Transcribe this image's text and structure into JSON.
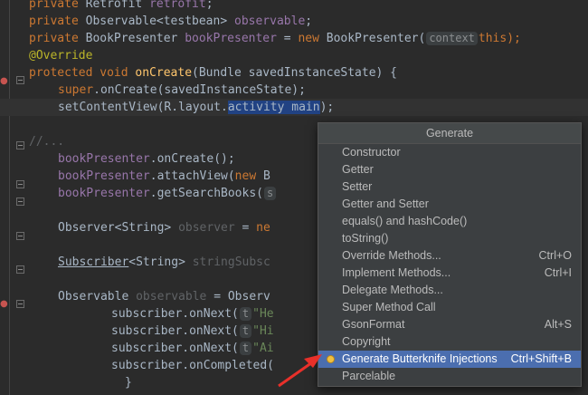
{
  "editor": {
    "lines": [
      {
        "tokens": [
          [
            "kw",
            "private "
          ],
          [
            "",
            "Retrofit "
          ],
          [
            "fld",
            "retrofit"
          ],
          [
            "",
            ";"
          ]
        ]
      },
      {
        "tokens": [
          [
            "kw",
            "private "
          ],
          [
            "",
            "Observable<testbean> "
          ],
          [
            "fld",
            "observable"
          ],
          [
            "",
            ";"
          ]
        ]
      },
      {
        "tokens": [
          [
            "kw",
            "private "
          ],
          [
            "",
            "BookPresenter "
          ],
          [
            "fld",
            "bookPresenter"
          ],
          [
            "",
            " = "
          ],
          [
            "kw",
            "new "
          ],
          [
            "",
            "BookPresenter("
          ]
        ]
      },
      {
        "tokens": [
          [
            "ann",
            "@Override"
          ]
        ]
      },
      {
        "tokens": [
          [
            "kw",
            "protected void "
          ],
          [
            "mth",
            "onCreate"
          ],
          [
            "",
            "(Bundle savedInstanceState) {"
          ]
        ]
      },
      {
        "tokens": [
          [
            "kw",
            "super"
          ],
          [
            "",
            ".onCreate(savedInstanceState);"
          ]
        ]
      },
      {
        "tokens": [
          [
            "",
            "setContentView(R.layout."
          ],
          [
            "hl",
            "activity main"
          ],
          [
            "",
            ");"
          ]
        ]
      },
      {
        "tokens": []
      },
      {
        "tokens": [
          [
            "gray",
            "//..."
          ]
        ]
      },
      {
        "tokens": [
          [
            "fld",
            "bookPresenter"
          ],
          [
            "",
            ".onCreate();"
          ]
        ]
      },
      {
        "tokens": [
          [
            "fld",
            "bookPresenter"
          ],
          [
            "",
            ".attachView("
          ],
          [
            "kw",
            "new "
          ],
          [
            "",
            "B"
          ]
        ]
      },
      {
        "tokens": [
          [
            "fld",
            "bookPresenter"
          ],
          [
            "",
            ".getSearchBooks("
          ]
        ]
      },
      {
        "tokens": []
      },
      {
        "tokens": [
          [
            "",
            "Observer<String> "
          ],
          [
            "gray",
            "observer"
          ],
          [
            "",
            " = "
          ],
          [
            "kw",
            "ne"
          ]
        ]
      },
      {
        "tokens": []
      },
      {
        "tokens": [
          [
            "u",
            "Subscriber"
          ],
          [
            "",
            "<String> "
          ],
          [
            "gray",
            "stringSubsc"
          ]
        ]
      },
      {
        "tokens": []
      },
      {
        "tokens": [
          [
            "",
            "Observable "
          ],
          [
            "gray",
            "observable"
          ],
          [
            "",
            " = Observ"
          ]
        ]
      },
      {
        "tokens": [
          [
            "",
            "subscriber.onNext("
          ]
        ]
      },
      {
        "tokens": [
          [
            "",
            "subscriber.onNext("
          ]
        ]
      },
      {
        "tokens": [
          [
            "",
            "subscriber.onNext("
          ]
        ]
      },
      {
        "tokens": [
          [
            "",
            "subscriber.onCompleted("
          ]
        ]
      },
      {
        "tokens": [
          [
            "",
            "}"
          ]
        ]
      }
    ],
    "hint_context": "context",
    "hint_this": "this);",
    "hint_s": "s",
    "hint_t": "t",
    "str_he": "\"He",
    "str_hi": "\"Hi",
    "str_ai": "\"Ai"
  },
  "popup": {
    "title": "Generate",
    "items": [
      {
        "label": "Constructor",
        "shortcut": ""
      },
      {
        "label": "Getter",
        "shortcut": ""
      },
      {
        "label": "Setter",
        "shortcut": ""
      },
      {
        "label": "Getter and Setter",
        "shortcut": ""
      },
      {
        "label": "equals() and hashCode()",
        "shortcut": ""
      },
      {
        "label": "toString()",
        "shortcut": ""
      },
      {
        "label": "Override Methods...",
        "shortcut": "Ctrl+O"
      },
      {
        "label": "Implement Methods...",
        "shortcut": "Ctrl+I"
      },
      {
        "label": "Delegate Methods...",
        "shortcut": ""
      },
      {
        "label": "Super Method Call",
        "shortcut": ""
      },
      {
        "label": "GsonFormat",
        "shortcut": "Alt+S"
      },
      {
        "label": "Copyright",
        "shortcut": ""
      },
      {
        "label": "Generate Butterknife Injections",
        "shortcut": "Ctrl+Shift+B",
        "selected": true,
        "icon": "butterknife-icon"
      },
      {
        "label": "Parcelable",
        "shortcut": ""
      }
    ]
  },
  "colors": {
    "selection": "#4b6eaf",
    "arrow": "#e8302a"
  }
}
